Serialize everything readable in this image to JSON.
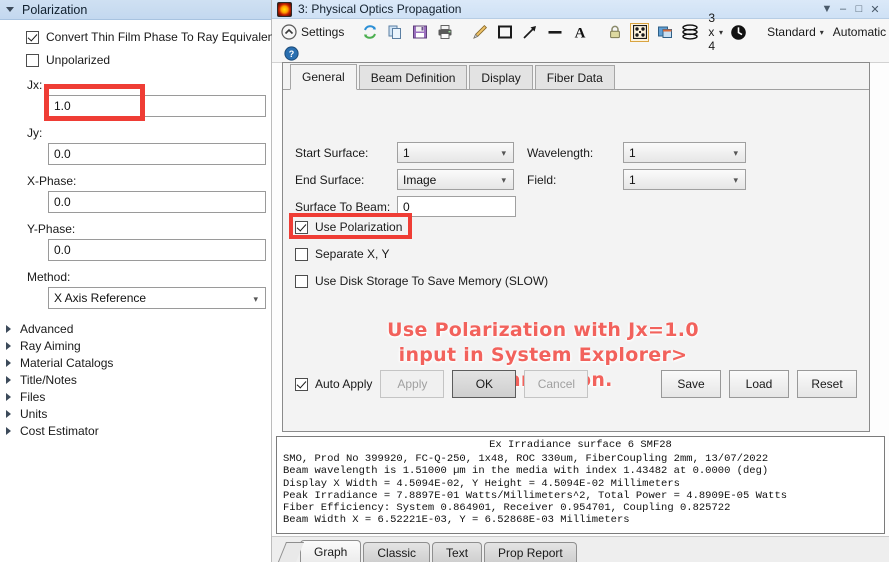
{
  "left_panel": {
    "header": {
      "label": "Polarization",
      "expanded_icon": "triangle-down-icon"
    },
    "checkboxes": [
      {
        "label": "Convert Thin Film Phase To Ray Equivalent",
        "checked": true
      },
      {
        "label": "Unpolarized",
        "checked": false
      }
    ],
    "fields": [
      {
        "label": "Jx:",
        "value": "1.0",
        "highlighted": true
      },
      {
        "label": "Jy:",
        "value": "0.0",
        "highlighted": false
      },
      {
        "label": "X-Phase:",
        "value": "0.0",
        "highlighted": false
      },
      {
        "label": "Y-Phase:",
        "value": "0.0",
        "highlighted": false
      }
    ],
    "method": {
      "label": "Method:",
      "value": "X Axis Reference"
    },
    "tree_items": [
      {
        "label": "Advanced"
      },
      {
        "label": "Ray Aiming"
      },
      {
        "label": "Material Catalogs"
      },
      {
        "label": "Title/Notes"
      },
      {
        "label": "Files"
      },
      {
        "label": "Units"
      },
      {
        "label": "Cost Estimator"
      }
    ]
  },
  "window": {
    "title": "3: Physical Optics Propagation",
    "controls": {
      "dropdown": "▼",
      "minimize": "–",
      "maximize": "□",
      "close": "✕"
    }
  },
  "toolbar": {
    "settings_label": "Settings",
    "grid_label": "3 x 4",
    "standard_label": "Standard",
    "automatic_label": "Automatic",
    "caret": "▾",
    "icons": [
      "collapse-icon",
      "refresh-icon",
      "copy-icon",
      "save-icon",
      "print-icon",
      "pencil-icon",
      "rectangle-icon",
      "arrow-icon",
      "line-icon",
      "text-icon",
      "lock-icon",
      "crosshair-icon",
      "window-icon",
      "layers-icon",
      "clock-icon",
      "help-icon"
    ]
  },
  "dialog": {
    "tabs": [
      {
        "label": "General",
        "active": true
      },
      {
        "label": "Beam Definition",
        "active": false
      },
      {
        "label": "Display",
        "active": false
      },
      {
        "label": "Fiber Data",
        "active": false
      }
    ],
    "left_fields": [
      {
        "label": "Start Surface:",
        "value": "1",
        "type": "combo"
      },
      {
        "label": "End Surface:",
        "value": "Image",
        "type": "combo"
      },
      {
        "label": "Surface To Beam:",
        "value": "0",
        "type": "text"
      }
    ],
    "right_fields": [
      {
        "label": "Wavelength:",
        "value": "1",
        "type": "combo"
      },
      {
        "label": "Field:",
        "value": "1",
        "type": "combo"
      }
    ],
    "checkboxes": [
      {
        "label": "Use Polarization",
        "checked": true,
        "highlighted": true
      },
      {
        "label": "Separate X, Y",
        "checked": false,
        "highlighted": false
      },
      {
        "label": "Use Disk Storage To Save Memory (SLOW)",
        "checked": false,
        "highlighted": false
      }
    ],
    "annotation": [
      "Use Polarization with Jx=1.0",
      "input in System Explorer>",
      "Polarization."
    ],
    "annotation_color": "#f2625c",
    "footer": {
      "auto_apply": {
        "label": "Auto Apply",
        "checked": true
      },
      "buttons": [
        {
          "label": "Apply",
          "state": "disabled"
        },
        {
          "label": "OK",
          "state": "primary"
        },
        {
          "label": "Cancel",
          "state": "disabled"
        }
      ],
      "right_buttons": [
        {
          "label": "Save"
        },
        {
          "label": "Load"
        },
        {
          "label": "Reset"
        }
      ]
    }
  },
  "report": {
    "title": "Ex Irradiance surface 6 SMF28",
    "lines": [
      "SMO, Prod No 399920, FC-Q-250, 1x48, ROC 330um, FiberCoupling 2mm, 13/07/2022",
      "Beam wavelength is 1.51000 µm in the media with index 1.43482 at 0.0000 (deg)",
      "Display X Width = 4.5094E-02, Y Height = 4.5094E-02 Millimeters",
      "Peak Irradiance = 7.8897E-01 Watts/Millimeters^2, Total Power = 4.8909E-05 Watts",
      "Fiber Efficiency: System 0.864901, Receiver 0.954701, Coupling 0.825722",
      "Beam Width X = 6.52221E-03, Y = 6.52868E-03 Millimeters"
    ]
  },
  "bottom_tabs": [
    {
      "label": "Graph",
      "active": true
    },
    {
      "label": "Classic",
      "active": false
    },
    {
      "label": "Text",
      "active": false
    },
    {
      "label": "Prop Report",
      "active": false
    }
  ]
}
